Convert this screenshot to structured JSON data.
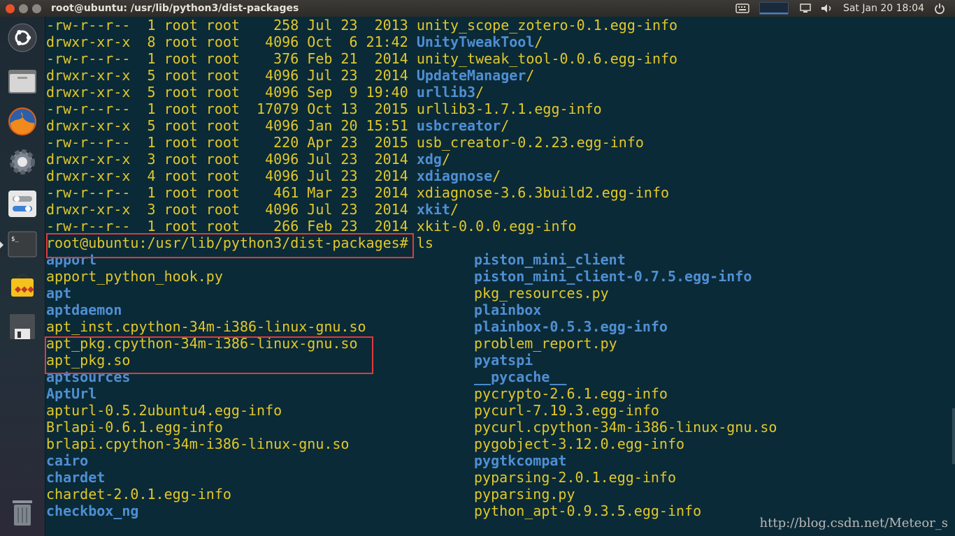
{
  "window": {
    "title": "root@ubuntu: /usr/lib/python3/dist-packages"
  },
  "panel": {
    "clock": "Sat Jan 20 18:04",
    "icons": [
      "keyboard-icon",
      "system-monitor-icon",
      "screen-icon",
      "volume-icon",
      "power-icon"
    ]
  },
  "launcher": {
    "items": [
      "ubuntu-dash",
      "files",
      "firefox",
      "system-settings",
      "software-settings",
      "terminal",
      "software-center",
      "disks",
      "trash"
    ]
  },
  "listing_long": [
    {
      "perm": "-rw-r--r--",
      "links": "1",
      "owner": "root",
      "group": "root",
      "size": "258",
      "date": "Jul 23  2013",
      "name": "unity_scope_zotero-0.1.egg-info",
      "type": "file"
    },
    {
      "perm": "drwxr-xr-x",
      "links": "8",
      "owner": "root",
      "group": "root",
      "size": "4096",
      "date": "Oct  6 21:42",
      "name": "UnityTweakTool",
      "type": "dir"
    },
    {
      "perm": "-rw-r--r--",
      "links": "1",
      "owner": "root",
      "group": "root",
      "size": "376",
      "date": "Feb 21  2014",
      "name": "unity_tweak_tool-0.0.6.egg-info",
      "type": "file"
    },
    {
      "perm": "drwxr-xr-x",
      "links": "5",
      "owner": "root",
      "group": "root",
      "size": "4096",
      "date": "Jul 23  2014",
      "name": "UpdateManager",
      "type": "dir"
    },
    {
      "perm": "drwxr-xr-x",
      "links": "5",
      "owner": "root",
      "group": "root",
      "size": "4096",
      "date": "Sep  9 19:40",
      "name": "urllib3",
      "type": "dir"
    },
    {
      "perm": "-rw-r--r--",
      "links": "1",
      "owner": "root",
      "group": "root",
      "size": "17079",
      "date": "Oct 13  2015",
      "name": "urllib3-1.7.1.egg-info",
      "type": "file"
    },
    {
      "perm": "drwxr-xr-x",
      "links": "5",
      "owner": "root",
      "group": "root",
      "size": "4096",
      "date": "Jan 20 15:51",
      "name": "usbcreator",
      "type": "dir"
    },
    {
      "perm": "-rw-r--r--",
      "links": "1",
      "owner": "root",
      "group": "root",
      "size": "220",
      "date": "Apr 23  2015",
      "name": "usb_creator-0.2.23.egg-info",
      "type": "file"
    },
    {
      "perm": "drwxr-xr-x",
      "links": "3",
      "owner": "root",
      "group": "root",
      "size": "4096",
      "date": "Jul 23  2014",
      "name": "xdg",
      "type": "dir"
    },
    {
      "perm": "drwxr-xr-x",
      "links": "4",
      "owner": "root",
      "group": "root",
      "size": "4096",
      "date": "Jul 23  2014",
      "name": "xdiagnose",
      "type": "dir"
    },
    {
      "perm": "-rw-r--r--",
      "links": "1",
      "owner": "root",
      "group": "root",
      "size": "461",
      "date": "Mar 23  2014",
      "name": "xdiagnose-3.6.3build2.egg-info",
      "type": "file"
    },
    {
      "perm": "drwxr-xr-x",
      "links": "3",
      "owner": "root",
      "group": "root",
      "size": "4096",
      "date": "Jul 23  2014",
      "name": "xkit",
      "type": "dir"
    },
    {
      "perm": "-rw-r--r--",
      "links": "1",
      "owner": "root",
      "group": "root",
      "size": "266",
      "date": "Feb 23  2014",
      "name": "xkit-0.0.0.egg-info",
      "type": "file"
    }
  ],
  "prompt": {
    "text": "root@ubuntu:/usr/lib/python3/dist-packages#",
    "command": " ls"
  },
  "ls_left": [
    {
      "name": "apport",
      "type": "dir"
    },
    {
      "name": "apport_python_hook.py",
      "type": "file"
    },
    {
      "name": "apt",
      "type": "dir"
    },
    {
      "name": "aptdaemon",
      "type": "dir"
    },
    {
      "name": "apt_inst.cpython-34m-i386-linux-gnu.so",
      "type": "file"
    },
    {
      "name": "apt_pkg.cpython-34m-i386-linux-gnu.so",
      "type": "file"
    },
    {
      "name": "apt_pkg.so",
      "type": "file"
    },
    {
      "name": "aptsources",
      "type": "dir"
    },
    {
      "name": "AptUrl",
      "type": "dir"
    },
    {
      "name": "apturl-0.5.2ubuntu4.egg-info",
      "type": "file"
    },
    {
      "name": "Brlapi-0.6.1.egg-info",
      "type": "file"
    },
    {
      "name": "brlapi.cpython-34m-i386-linux-gnu.so",
      "type": "file"
    },
    {
      "name": "cairo",
      "type": "dir"
    },
    {
      "name": "chardet",
      "type": "dir"
    },
    {
      "name": "chardet-2.0.1.egg-info",
      "type": "file"
    },
    {
      "name": "checkbox_ng",
      "type": "dir"
    }
  ],
  "ls_right": [
    {
      "name": "piston_mini_client",
      "type": "dir"
    },
    {
      "name": "piston_mini_client-0.7.5.egg-info",
      "type": "dir"
    },
    {
      "name": "pkg_resources.py",
      "type": "file"
    },
    {
      "name": "plainbox",
      "type": "dir"
    },
    {
      "name": "plainbox-0.5.3.egg-info",
      "type": "dir"
    },
    {
      "name": "problem_report.py",
      "type": "file"
    },
    {
      "name": "pyatspi",
      "type": "dir"
    },
    {
      "name": "__pycache__",
      "type": "dir"
    },
    {
      "name": "pycrypto-2.6.1.egg-info",
      "type": "file"
    },
    {
      "name": "pycurl-7.19.3.egg-info",
      "type": "file"
    },
    {
      "name": "pycurl.cpython-34m-i386-linux-gnu.so",
      "type": "file"
    },
    {
      "name": "pygobject-3.12.0.egg-info",
      "type": "file"
    },
    {
      "name": "pygtkcompat",
      "type": "dir"
    },
    {
      "name": "pyparsing-2.0.1.egg-info",
      "type": "file"
    },
    {
      "name": "pyparsing.py",
      "type": "file"
    },
    {
      "name": "python_apt-0.9.3.5.egg-info",
      "type": "file"
    }
  ],
  "watermark": "http://blog.csdn.net/Meteor_s",
  "colors": {
    "background": "#0b2a37",
    "file_text": "#e1c82a",
    "dir_text": "#4f8fd3",
    "highlight": "#e03a3a"
  }
}
